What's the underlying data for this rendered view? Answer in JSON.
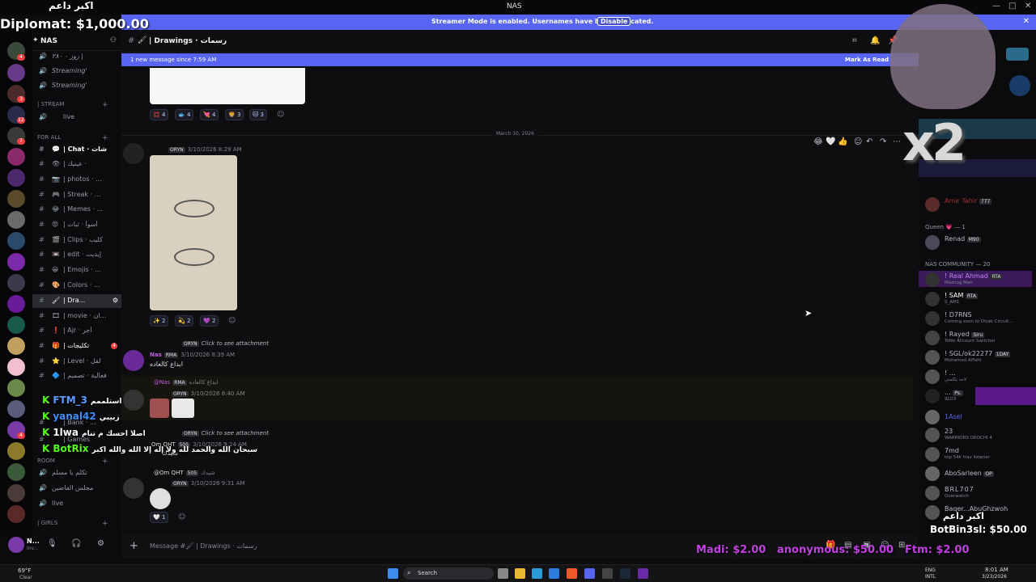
{
  "window": {
    "title": "NAS",
    "controls": [
      "—",
      "□",
      "✕"
    ]
  },
  "streamer": {
    "message": "Streamer Mode is enabled. Usernames have been truncated.",
    "button": "Disable"
  },
  "server": {
    "name": "NAS"
  },
  "rail_badges": [
    "4",
    "3",
    "12",
    "7",
    "4"
  ],
  "channels": {
    "items": [
      {
        "emoji": "🔊",
        "label": "زوز ۰ ۲۸۰ |",
        "kind": "voice"
      },
      {
        "emoji": "🔊",
        "label": "Streaming'",
        "kind": "voice"
      },
      {
        "emoji": "🔊",
        "label": "Streaming'",
        "kind": "voice"
      }
    ],
    "cat_stream": "| STREAM",
    "live": "live",
    "cat_forall": "For All",
    "text": [
      {
        "emoji": "💬",
        "label": "| Chat · شات"
      },
      {
        "emoji": "👁",
        "label": "| عينيك ·"
      },
      {
        "emoji": "📷",
        "label": "| photos · ..."
      },
      {
        "emoji": "🎮",
        "label": "| Streak · ..."
      },
      {
        "emoji": "😂",
        "label": "| Memes · ..."
      },
      {
        "emoji": "😡",
        "label": "| أسوأ · ثبات"
      },
      {
        "emoji": "🎬",
        "label": "| Clips · كليب"
      },
      {
        "emoji": "📼",
        "label": "| edit · إيديت"
      },
      {
        "emoji": "😀",
        "label": "| Emojis · ..."
      },
      {
        "emoji": "🎨",
        "label": "| Colors · ..."
      },
      {
        "emoji": "🖌",
        "label": "| Dra..."
      },
      {
        "emoji": "🎞",
        "label": "| movie · ان..."
      },
      {
        "emoji": "❗",
        "label": "| Ajr · أجر"
      },
      {
        "emoji": "🎁",
        "label": "| تكليجات",
        "badge": "4"
      },
      {
        "emoji": "⭐",
        "label": "| Level · لفل"
      },
      {
        "emoji": "🔷",
        "label": "| فعالية · تصميم"
      }
    ],
    "extra": [
      "| Bank · ...",
      "| Games"
    ],
    "cat_room": "Room",
    "rooms": [
      "تكلم يا مسلم",
      "مجلس الفاضين",
      "live"
    ],
    "cat_girls": "| girls"
  },
  "user": {
    "name": "N...",
    "status": "Inv..."
  },
  "channel": {
    "header": "| Drawings · رسمات",
    "composer": "Message #🖌 | Drawings · رسمات"
  },
  "newbar": {
    "left": "1 new message since 7:59 AM",
    "right": "Mark As Read"
  },
  "reactions_top": [
    "4",
    "4",
    "4",
    "3",
    "3"
  ],
  "date_divider": "March 10, 2026",
  "messages": [
    {
      "author": "ORYN",
      "time": "3/10/2026 8:29 AM"
    },
    {
      "reply": "ORYN",
      "reply_text": "Click to see attachment",
      "author": "Nas",
      "role": "RMA",
      "time": "3/10/2026 8:39 AM",
      "text": "ابداع كالعاده"
    },
    {
      "reply": "@Nas",
      "role": "RMA",
      "reply_text": "ابداع كالعاده",
      "author": "ORYN",
      "time": "3/10/2026 8:40 AM"
    },
    {
      "reply": "ORYN",
      "reply_text": "Click to see attachment",
      "author": "Om QHT",
      "role": "505",
      "time": "3/10/2026 9:24 AM",
      "text": "شيدك"
    },
    {
      "reply": "@Om QHT",
      "role": "505",
      "reply_text": "شيدك",
      "author": "ORYN",
      "time": "3/10/2026 9:31 AM"
    }
  ],
  "reactions_mid": [
    "2",
    "2",
    "2"
  ],
  "reaction_last": "1",
  "members": {
    "amir_role": "777",
    "queen": "Queen 💗 — 1",
    "renad": "Renad",
    "renad_tag": "M90",
    "community": "NAS COMMUNITY — 20",
    "list": [
      {
        "name": "! Real Ahmad",
        "tag": "RTA",
        "status": "Maznog Man"
      },
      {
        "name": "! SAM",
        "tag": "RTA",
        "status": "S_AM1"
      },
      {
        "name": "! D7RNS",
        "status": "Coming soon to Dirab Circuit..."
      },
      {
        "name": "! Rayed",
        "tag": "Siru",
        "status": "ToNo Account Switcher"
      },
      {
        "name": "! SGL/ok22277",
        "tag": "1DAY",
        "status": "Mohamed AlFahi"
      },
      {
        "name": "! ...",
        "status": "لاحد يكلمني"
      },
      {
        "name": "...",
        "tag": "Ps.",
        "status": "9LO3"
      },
      {
        "name": "1Asel",
        "status": ""
      },
      {
        "name": "23",
        "status": "WARRIORS OROCHI 4"
      },
      {
        "name": "7md",
        "status": "top 54k trav listener"
      },
      {
        "name": "AboSarleen",
        "tag": "OP",
        "status": ""
      },
      {
        "name": "BRL707",
        "status": "Overwatch"
      },
      {
        "name": "Baqer...AbuGhzwoh",
        "status": ""
      }
    ]
  },
  "overlay": {
    "top_arabic": "اكبر داعم",
    "diplomat": "Diplomat: $1,000.00",
    "x2": "x2",
    "chat": [
      {
        "nick": "FTM_3",
        "color": "#5b9bff",
        "msg": "استلممم"
      },
      {
        "nick": "yanal42",
        "color": "#3f8cff",
        "msg": "زبيبي"
      },
      {
        "nick": "1lwa",
        "color": "#ffffff",
        "msg": "اصلا احسك م تنام"
      },
      {
        "nick": "BotRix",
        "color": "#53fc18",
        "msg": "سبحان الله والحمد لله ولا إله إلا الله والله اكبر"
      }
    ],
    "bottom_right_arabic": "اكبر داعم",
    "bottom_right_amount": "BotBin3sl: $50.00",
    "donations": [
      "Madi: $2.00",
      "anonymous: $50.00",
      "Ftm: $2.00"
    ]
  },
  "taskbar": {
    "weather": "69°F",
    "weather_sub": "Clear",
    "search": "Search",
    "lang": "ENG",
    "lang2": "INTL",
    "time": "8:01 AM",
    "date": "3/23/2026"
  }
}
